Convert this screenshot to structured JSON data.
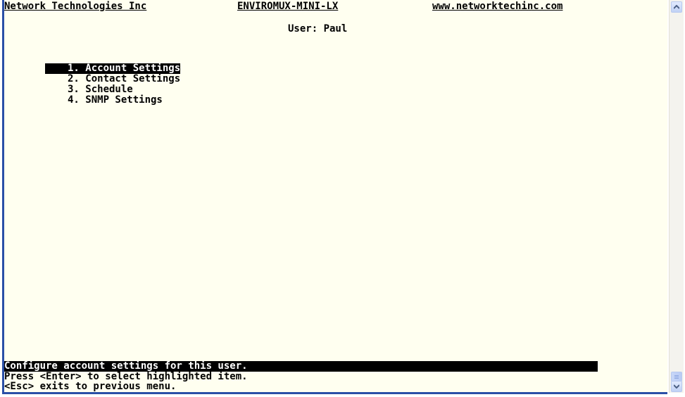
{
  "header": {
    "company": "Network Technologies Inc",
    "product": "ENVIROMUX-MINI-LX",
    "website": "www.networktechinc.com"
  },
  "user_line": "User: Paul",
  "menu": {
    "selected_index": 0,
    "items": [
      {
        "label": "1. Account Settings"
      },
      {
        "label": "2. Contact Settings"
      },
      {
        "label": "3. Schedule"
      },
      {
        "label": "4. SNMP Settings"
      }
    ]
  },
  "footer": {
    "status": "Configure account settings for this user.",
    "hint_enter": "Press <Enter> to select highlighted item.",
    "hint_esc": "<Esc> exits to previous menu."
  },
  "icons": {
    "scroll_up": "chevron-up-icon",
    "scroll_down": "chevron-down-icon"
  },
  "colors": {
    "terminal_background": "#fffff0",
    "text": "#000000",
    "highlight_background": "#000000",
    "highlight_text": "#ffffff",
    "frame": "#2a4fa6"
  }
}
